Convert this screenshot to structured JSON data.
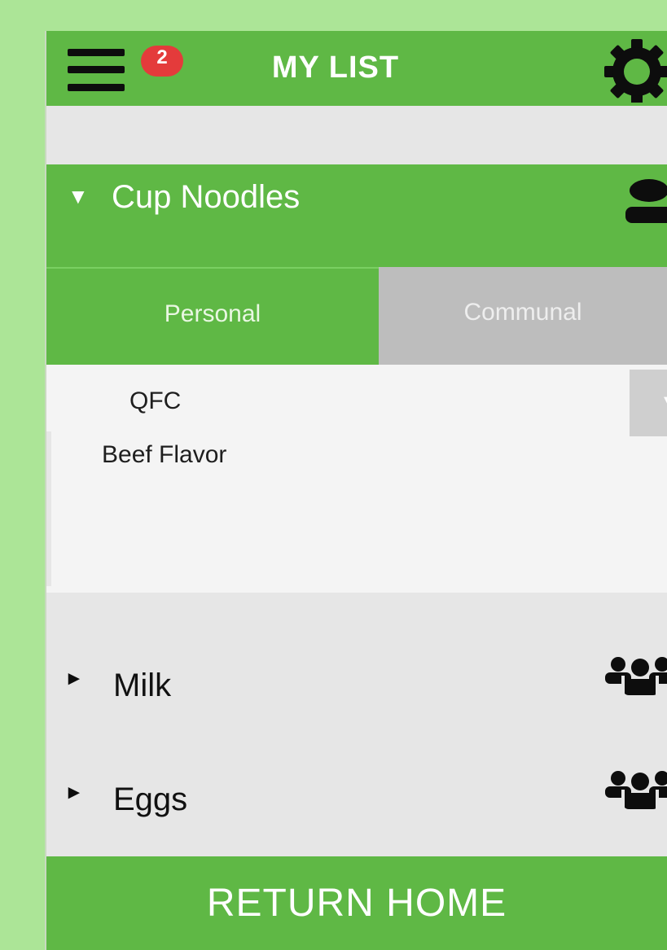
{
  "header": {
    "title": "MY LIST",
    "notification_count": "2",
    "menu_icon": "hamburger-icon",
    "settings_icon": "gear-icon"
  },
  "expanded_item": {
    "name": "Cup Noodles",
    "owner_icon": "person-icon",
    "tabs": [
      {
        "label": "Personal",
        "selected": true
      },
      {
        "label": "Communal",
        "selected": false
      }
    ],
    "store": "QFC",
    "description": "Beef Flavor"
  },
  "items": [
    {
      "name": "Milk",
      "icon": "group-icon"
    },
    {
      "name": "Eggs",
      "icon": "group-icon"
    }
  ],
  "footer": {
    "label": "RETURN HOME"
  },
  "colors": {
    "background": "#ace597",
    "accent_green": "#5fb845",
    "tab_inactive": "#bdbdbd",
    "badge_red": "#e43b3b"
  }
}
